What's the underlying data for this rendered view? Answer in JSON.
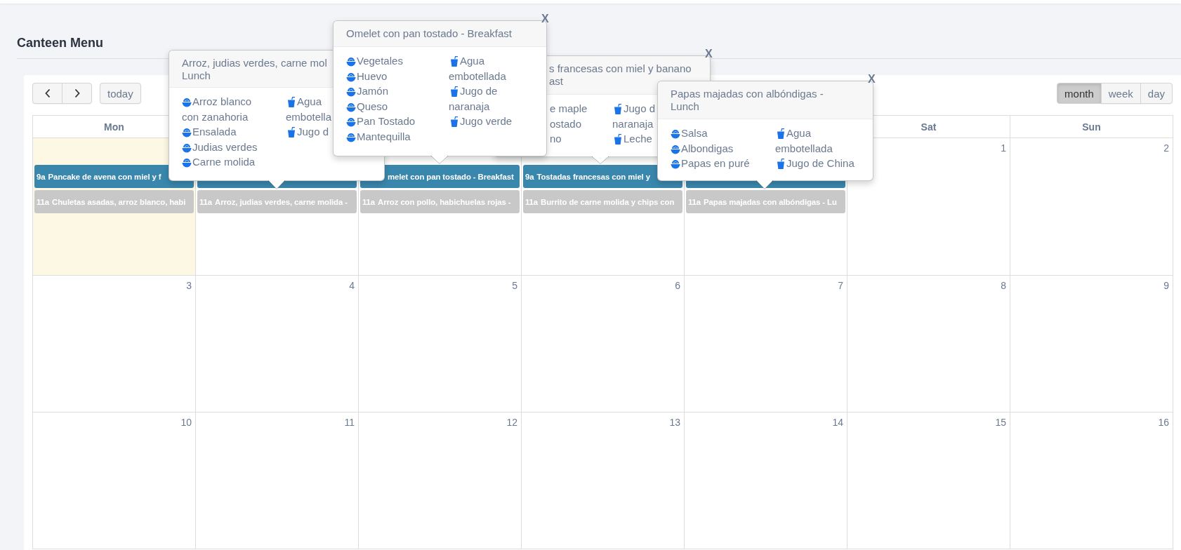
{
  "page_title": "Canteen Menu",
  "toolbar": {
    "nav": [
      {
        "kind": "prev"
      },
      {
        "kind": "next"
      }
    ],
    "today": "today",
    "views": [
      {
        "label": "month",
        "selected": true
      },
      {
        "label": "week",
        "selected": false
      },
      {
        "label": "day",
        "selected": false
      }
    ]
  },
  "calendar": {
    "headers": {
      "mon": "Mon",
      "sat": "Sat",
      "sun": "Sun"
    },
    "weeks": [
      {
        "days": [
          {
            "today": true,
            "events": [
              {
                "kind": "breakfast",
                "time": "9a",
                "title": "Pancake de avena con miel y f"
              },
              {
                "kind": "lunch",
                "time": "11a",
                "title": "Chuletas asadas, arroz blanco, habi"
              }
            ]
          },
          {
            "today": false,
            "events": [
              {
                "kind": "breakfast"
              },
              {
                "kind": "lunch",
                "time": "11a",
                "title": "Arroz, judias verdes, carne molida -"
              }
            ]
          },
          {
            "today": false,
            "events": [
              {
                "kind": "breakfast",
                "title": "melet con pan tostado - Breakfast"
              },
              {
                "kind": "lunch",
                "time": "11a",
                "title": "Arroz con pollo, habichuelas rojas -"
              }
            ]
          },
          {
            "today": false,
            "events": [
              {
                "kind": "breakfast",
                "time": "9a",
                "title": "Tostadas francesas con miel y"
              },
              {
                "kind": "lunch",
                "time": "11a",
                "title": "Burrito de carne molida y chips con"
              }
            ]
          },
          {
            "today": false,
            "events": [
              {
                "kind": "breakfast"
              },
              {
                "kind": "lunch",
                "time": "11a",
                "title": "Papas majadas con albóndigas - Lu"
              }
            ]
          },
          {
            "today": false,
            "number": "1"
          },
          {
            "today": false,
            "number": "2"
          }
        ]
      },
      {
        "days": [
          {
            "today": false,
            "number": "3"
          },
          {
            "today": false,
            "number": "4"
          },
          {
            "today": false,
            "number": "5"
          },
          {
            "today": false,
            "number": "6"
          },
          {
            "today": false,
            "number": "7"
          },
          {
            "today": false,
            "number": "8"
          },
          {
            "today": false,
            "number": "9"
          }
        ]
      },
      {
        "days": [
          {
            "today": false,
            "number": "10"
          },
          {
            "today": false,
            "number": "11"
          },
          {
            "today": false,
            "number": "12"
          },
          {
            "today": false,
            "number": "13"
          },
          {
            "today": false,
            "number": "14"
          },
          {
            "today": false,
            "number": "15"
          },
          {
            "today": false,
            "number": "16"
          }
        ]
      }
    ]
  },
  "popovers": [
    {
      "title_lines": [
        "Arroz, judias verdes, carne mol",
        "Lunch"
      ],
      "left": [
        {
          "kind": "food",
          "lines": [
            "Arroz blanco",
            "con zanahoria"
          ]
        },
        {
          "kind": "food",
          "lines": [
            "Ensalada"
          ]
        },
        {
          "kind": "food",
          "lines": [
            "Judias verdes"
          ]
        },
        {
          "kind": "food",
          "lines": [
            "Carne molida"
          ]
        }
      ],
      "right": [
        {
          "kind": "drink",
          "lines": [
            "Agua",
            "embotella"
          ]
        },
        {
          "kind": "drink",
          "lines": [
            "Jugo d"
          ]
        }
      ]
    },
    {
      "title_lines": [
        "Omelet con pan tostado - Breakfast"
      ],
      "close": "X",
      "left": [
        {
          "kind": "food",
          "lines": [
            "Vegetales"
          ]
        },
        {
          "kind": "food",
          "lines": [
            "Huevo"
          ]
        },
        {
          "kind": "food",
          "lines": [
            "Jamón"
          ]
        },
        {
          "kind": "food",
          "lines": [
            "Queso"
          ]
        },
        {
          "kind": "food",
          "lines": [
            "Pan Tostado"
          ]
        },
        {
          "kind": "food",
          "lines": [
            "Mantequilla"
          ]
        }
      ],
      "right": [
        {
          "kind": "drink",
          "lines": [
            "Agua",
            "embotellada"
          ]
        },
        {
          "kind": "drink",
          "lines": [
            "Jugo de",
            "naranaja"
          ]
        },
        {
          "kind": "drink",
          "lines": [
            "Jugo verde"
          ]
        }
      ]
    },
    {
      "title_lines": [
        "s francesas con miel y banano",
        "ast"
      ],
      "close": "X",
      "left": [
        {
          "kind": "cut",
          "lines": [
            "e maple"
          ]
        },
        {
          "kind": "cut",
          "lines": [
            "ostado"
          ]
        },
        {
          "kind": "cut",
          "lines": [
            "no"
          ]
        }
      ],
      "right": [
        {
          "kind": "drink",
          "lines": [
            "Jugo d",
            "naranaja"
          ]
        },
        {
          "kind": "drink",
          "lines": [
            "Leche"
          ]
        }
      ]
    },
    {
      "title_lines": [
        "Papas majadas con albóndigas -",
        "Lunch"
      ],
      "close": "X",
      "left": [
        {
          "kind": "food",
          "lines": [
            "Salsa"
          ]
        },
        {
          "kind": "food",
          "lines": [
            "Albondigas"
          ]
        },
        {
          "kind": "food",
          "lines": [
            "Papas en puré"
          ]
        }
      ],
      "right": [
        {
          "kind": "drink",
          "lines": [
            "Agua",
            "embotellada"
          ]
        },
        {
          "kind": "drink",
          "lines": [
            "Jugo de China"
          ]
        }
      ]
    }
  ]
}
